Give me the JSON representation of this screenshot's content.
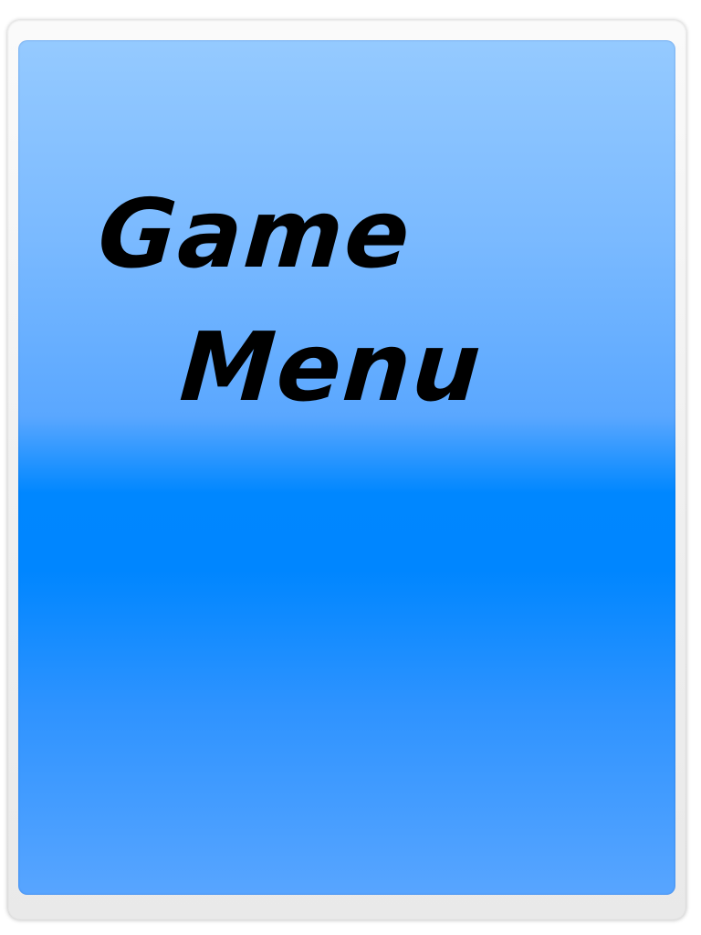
{
  "menu": {
    "title_line_1": "Game",
    "title_line_2": "Menu"
  },
  "colors": {
    "panel_top": "#95caff",
    "panel_mid": "#0087ff",
    "panel_bottom": "#58a5ff",
    "frame": "#f0f0f0",
    "title_text": "#000000"
  }
}
